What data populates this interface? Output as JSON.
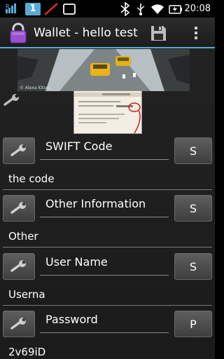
{
  "status_bar": {
    "carrier_badge": "1",
    "roaming_indicator": "R",
    "time": "20:08",
    "icons": [
      "sim-badge-icon",
      "no-signal-slash-icon",
      "notification-box-icon",
      "bluetooth-off-icon",
      "usb-icon",
      "wifi-icon",
      "battery-charging-icon"
    ]
  },
  "action_bar": {
    "title": "Wallet - hello test",
    "app_icon": "padlock-icon",
    "save_icon": "floppy-disk-icon",
    "overflow_icon": "overflow-menu-icon"
  },
  "photo": {
    "caption": "© Alexa Kitsos"
  },
  "fields": [
    {
      "label": "SWIFT Code",
      "button": "S",
      "value": "the code"
    },
    {
      "label": "Other Information",
      "button": "S",
      "value": "Other"
    },
    {
      "label": "User Name",
      "button": "S",
      "value": "Userna"
    },
    {
      "label": "Password",
      "button": "P",
      "value": "2v69iD"
    }
  ],
  "colors": {
    "accent_line": "#5aa9d6",
    "lock_purple": "#9b4fd0",
    "background": "#1e1e1e"
  }
}
